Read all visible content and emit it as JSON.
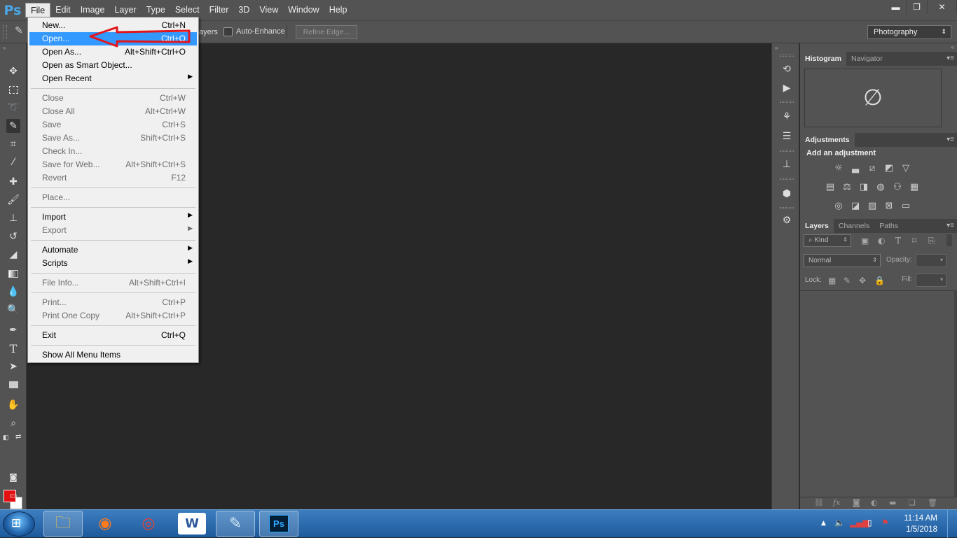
{
  "app": {
    "logo": "Ps"
  },
  "menubar": {
    "items": [
      "File",
      "Edit",
      "Image",
      "Layer",
      "Type",
      "Select",
      "Filter",
      "3D",
      "View",
      "Window",
      "Help"
    ],
    "active": "File"
  },
  "window_controls": {
    "minimize": "▬",
    "restore": "❐",
    "close": "✕"
  },
  "options_bar": {
    "layers_partial": "ayers",
    "auto_enhance_label": "Auto-Enhance",
    "refine_edge_label": "Refine Edge...",
    "workspace": "Photography"
  },
  "file_menu": {
    "groups": [
      [
        {
          "label": "New...",
          "shortcut": "Ctrl+N",
          "enabled": true
        },
        {
          "label": "Open...",
          "shortcut": "Ctrl+O",
          "enabled": true,
          "highlighted": true
        },
        {
          "label": "Open As...",
          "shortcut": "Alt+Shift+Ctrl+O",
          "enabled": true
        },
        {
          "label": "Open as Smart Object...",
          "shortcut": "",
          "enabled": true
        },
        {
          "label": "Open Recent",
          "shortcut": "",
          "enabled": true,
          "submenu": true
        }
      ],
      [
        {
          "label": "Close",
          "shortcut": "Ctrl+W",
          "enabled": false
        },
        {
          "label": "Close All",
          "shortcut": "Alt+Ctrl+W",
          "enabled": false
        },
        {
          "label": "Save",
          "shortcut": "Ctrl+S",
          "enabled": false
        },
        {
          "label": "Save As...",
          "shortcut": "Shift+Ctrl+S",
          "enabled": false
        },
        {
          "label": "Check In...",
          "shortcut": "",
          "enabled": false
        },
        {
          "label": "Save for Web...",
          "shortcut": "Alt+Shift+Ctrl+S",
          "enabled": false
        },
        {
          "label": "Revert",
          "shortcut": "F12",
          "enabled": false
        }
      ],
      [
        {
          "label": "Place...",
          "shortcut": "",
          "enabled": false
        }
      ],
      [
        {
          "label": "Import",
          "shortcut": "",
          "enabled": true,
          "submenu": true
        },
        {
          "label": "Export",
          "shortcut": "",
          "enabled": false,
          "submenu": true
        }
      ],
      [
        {
          "label": "Automate",
          "shortcut": "",
          "enabled": true,
          "submenu": true
        },
        {
          "label": "Scripts",
          "shortcut": "",
          "enabled": true,
          "submenu": true
        }
      ],
      [
        {
          "label": "File Info...",
          "shortcut": "Alt+Shift+Ctrl+I",
          "enabled": false
        }
      ],
      [
        {
          "label": "Print...",
          "shortcut": "Ctrl+P",
          "enabled": false
        },
        {
          "label": "Print One Copy",
          "shortcut": "Alt+Shift+Ctrl+P",
          "enabled": false
        }
      ],
      [
        {
          "label": "Exit",
          "shortcut": "Ctrl+Q",
          "enabled": true
        }
      ],
      [
        {
          "label": "Show All Menu Items",
          "shortcut": "",
          "enabled": true
        }
      ]
    ]
  },
  "panels": {
    "histogram_tabs": [
      "Histogram",
      "Navigator"
    ],
    "adjustments_tab": "Adjustments",
    "adjustments_hint": "Add an adjustment",
    "layers_tabs": [
      "Layers",
      "Channels",
      "Paths"
    ],
    "kind_filter": "Kind",
    "blend_mode": "Normal",
    "opacity_label": "Opacity:",
    "lock_label": "Lock:",
    "fill_label": "Fill:"
  },
  "colors": {
    "foreground": "#e30f10",
    "background": "#ffffff",
    "menu_highlight": "#3399ff",
    "annotation_arrow": "#e0161d"
  },
  "taskbar": {
    "apps": [
      "file-explorer",
      "firefox",
      "chrome",
      "word",
      "notepad",
      "photoshop"
    ],
    "photoshop_label": "Ps",
    "time": "11:14 AM",
    "date": "1/5/2018"
  }
}
